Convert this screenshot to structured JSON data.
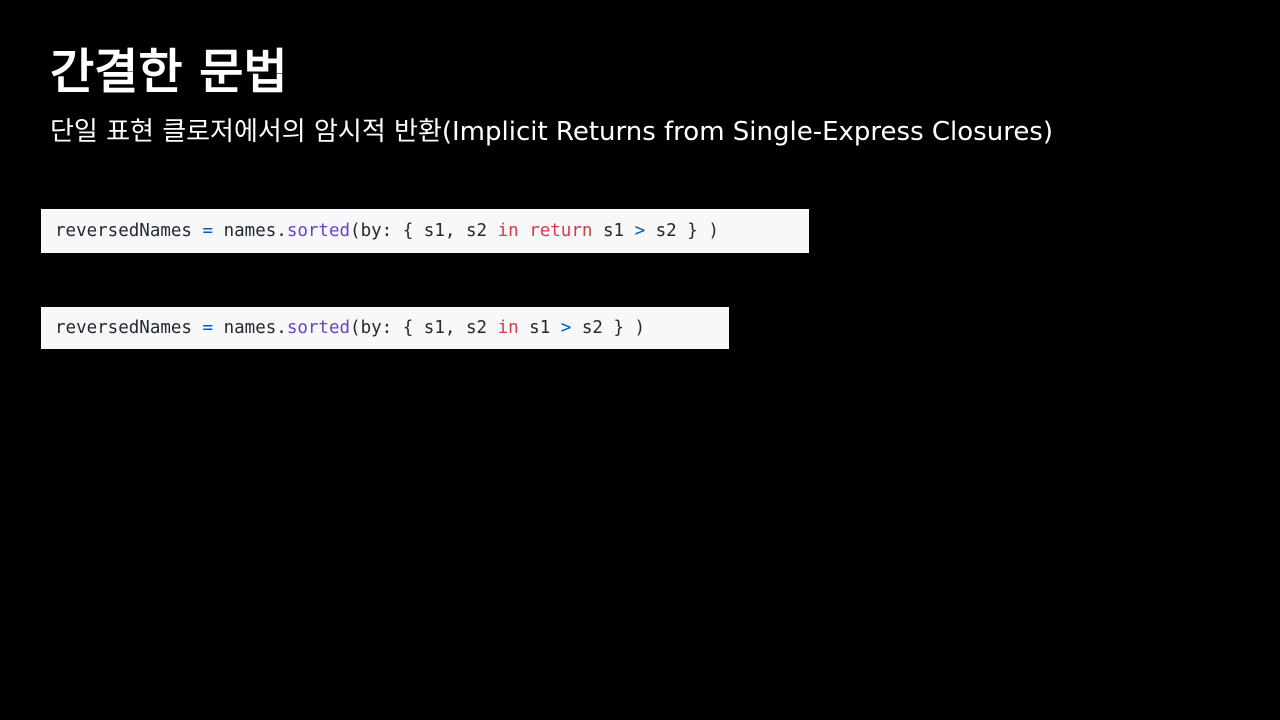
{
  "slide": {
    "title": "간결한 문법",
    "subtitle": "단일 표현 클로저에서의 암시적 반환(Implicit Returns from Single-Express Closures)"
  },
  "code_blocks": [
    {
      "tokens": [
        {
          "text": "reversedNames ",
          "kind": "plain"
        },
        {
          "text": "=",
          "kind": "op"
        },
        {
          "text": " names.",
          "kind": "plain"
        },
        {
          "text": "sorted",
          "kind": "fn"
        },
        {
          "text": "(by: { s1, s2 ",
          "kind": "plain"
        },
        {
          "text": "in",
          "kind": "kw"
        },
        {
          "text": " ",
          "kind": "plain"
        },
        {
          "text": "return",
          "kind": "kw"
        },
        {
          "text": " s1 ",
          "kind": "plain"
        },
        {
          "text": ">",
          "kind": "op"
        },
        {
          "text": " s2 } )",
          "kind": "plain"
        }
      ]
    },
    {
      "tokens": [
        {
          "text": "reversedNames ",
          "kind": "plain"
        },
        {
          "text": "=",
          "kind": "op"
        },
        {
          "text": " names.",
          "kind": "plain"
        },
        {
          "text": "sorted",
          "kind": "fn"
        },
        {
          "text": "(by: { s1, s2 ",
          "kind": "plain"
        },
        {
          "text": "in",
          "kind": "kw"
        },
        {
          "text": " s1 ",
          "kind": "plain"
        },
        {
          "text": ">",
          "kind": "op"
        },
        {
          "text": " s2 } )",
          "kind": "plain"
        }
      ]
    }
  ],
  "colors": {
    "background": "#000000",
    "text": "#ffffff",
    "code_background": "#f6f8fa",
    "code_text": "#24292e",
    "operator": "#005cc5",
    "function": "#6f42c1",
    "keyword": "#d73a49"
  }
}
